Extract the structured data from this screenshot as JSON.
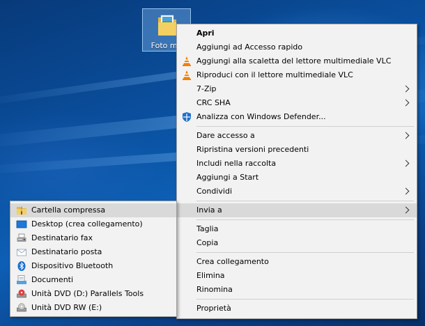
{
  "desktop": {
    "icon_label": "Foto ma",
    "icon_name": "folder-icon"
  },
  "context_menu": {
    "items": [
      {
        "label": "Apri",
        "bold": true
      },
      {
        "label": "Aggiungi ad Accesso rapido"
      },
      {
        "label": "Aggiungi alla scaletta del lettore multimediale VLC",
        "icon": "vlc-icon"
      },
      {
        "label": "Riproduci con il lettore multimediale VLC",
        "icon": "vlc-icon"
      },
      {
        "label": "7-Zip",
        "submenu": true
      },
      {
        "label": "CRC SHA",
        "submenu": true
      },
      {
        "label": "Analizza con Windows Defender...",
        "icon": "windows-defender-icon"
      },
      {
        "label": "Dare accesso a",
        "submenu": true
      },
      {
        "label": "Ripristina versioni precedenti"
      },
      {
        "label": "Includi nella raccolta",
        "submenu": true
      },
      {
        "label": "Aggiungi a Start"
      },
      {
        "label": "Condividi",
        "submenu": true
      },
      {
        "label": "Invia a",
        "submenu": true,
        "highlighted": true
      },
      {
        "label": "Taglia"
      },
      {
        "label": "Copia"
      },
      {
        "label": "Crea collegamento"
      },
      {
        "label": "Elimina"
      },
      {
        "label": "Rinomina"
      },
      {
        "label": "Proprietà"
      }
    ]
  },
  "send_to_menu": {
    "items": [
      {
        "label": "Cartella compressa",
        "icon": "zip-folder-icon",
        "highlighted": true
      },
      {
        "label": "Desktop (crea collegamento)",
        "icon": "desktop-icon"
      },
      {
        "label": "Destinatario fax",
        "icon": "fax-icon"
      },
      {
        "label": "Destinatario posta",
        "icon": "mail-icon"
      },
      {
        "label": "Dispositivo Bluetooth",
        "icon": "bluetooth-icon"
      },
      {
        "label": "Documenti",
        "icon": "documents-icon"
      },
      {
        "label": "Unità DVD (D:) Parallels Tools",
        "icon": "dvd-drive-icon"
      },
      {
        "label": "Unità DVD RW (E:)",
        "icon": "dvd-rw-drive-icon"
      }
    ]
  },
  "colors": {
    "menu_background": "#f2f2f2",
    "highlight": "#d9d9d9",
    "desktop_blue": "#0a4f9e"
  }
}
